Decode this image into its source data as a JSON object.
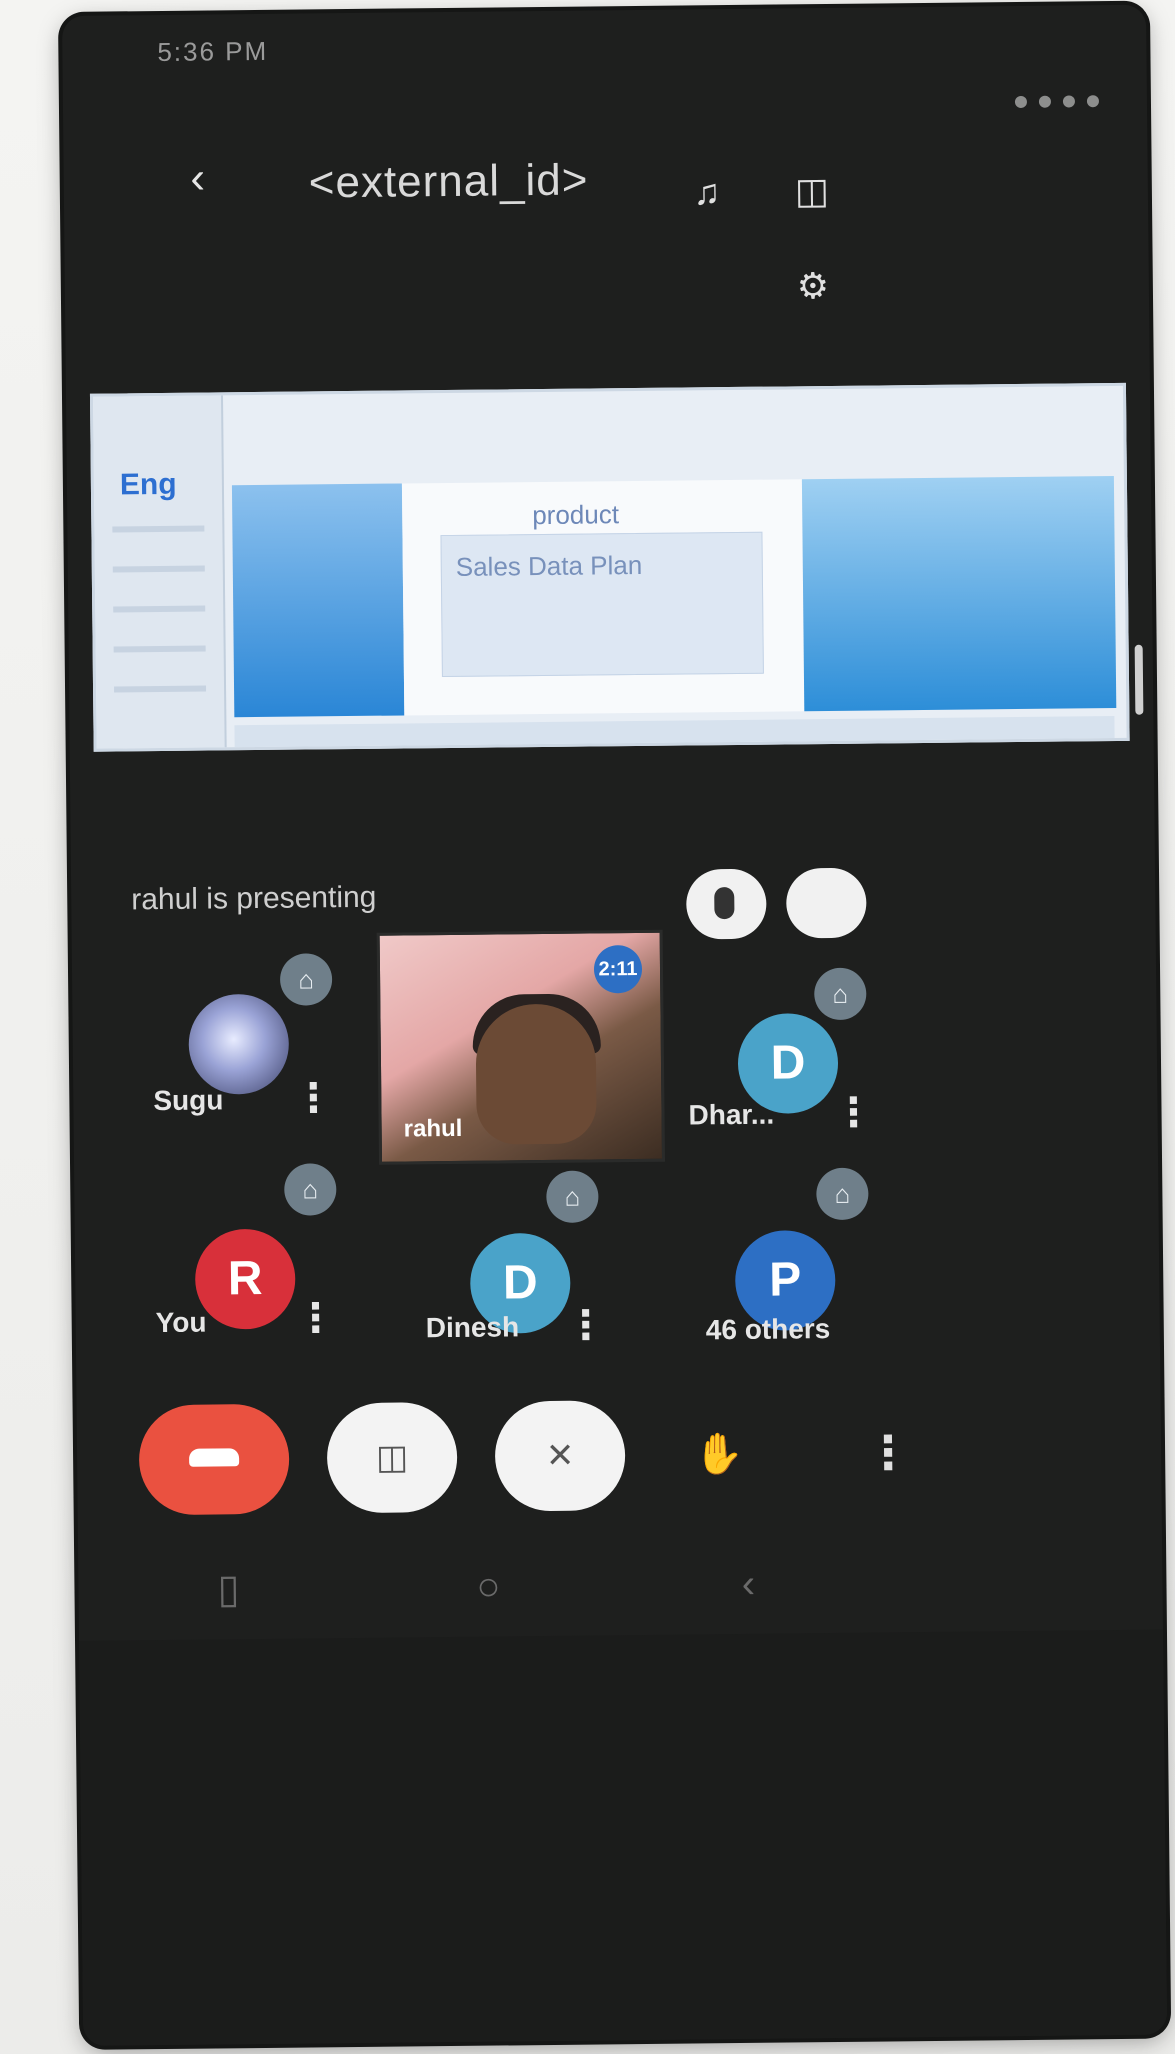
{
  "status": {
    "time": "5:36 PM"
  },
  "header": {
    "title": "<external_id>",
    "icons": [
      "back-icon",
      "bluetooth-icon",
      "camera-switch-icon",
      "settings-icon"
    ]
  },
  "shared_screen": {
    "app_label": "Eng",
    "doc_title": "product",
    "doc_text": "Sales Data Plan"
  },
  "presenter": {
    "text": "rahul is presenting",
    "buttons": [
      "mic-icon",
      "settings-icon"
    ]
  },
  "participants": [
    {
      "name": "Sugu",
      "avatar": "image",
      "pinned": true
    },
    {
      "name": "rahul",
      "video": true,
      "badge": "2:11"
    },
    {
      "name": "Dhar...",
      "initial": "D",
      "color": "#4aa3c9",
      "pinned": true
    },
    {
      "name": "You",
      "initial": "R",
      "color": "#d8303a",
      "pinned": true
    },
    {
      "name": "Dinesh",
      "initial": "D",
      "color": "#4aa3c9",
      "pinned": true
    },
    {
      "name": "46 others",
      "initial": "P",
      "color": "#2d6fc4",
      "pinned": true
    }
  ],
  "call_controls": {
    "items": [
      "end-call-icon",
      "video-off-icon",
      "mute-icon",
      "raise-hand-icon",
      "more-options-icon"
    ]
  },
  "navigation": {
    "items": [
      "recents-icon",
      "home-icon",
      "back-icon"
    ]
  }
}
